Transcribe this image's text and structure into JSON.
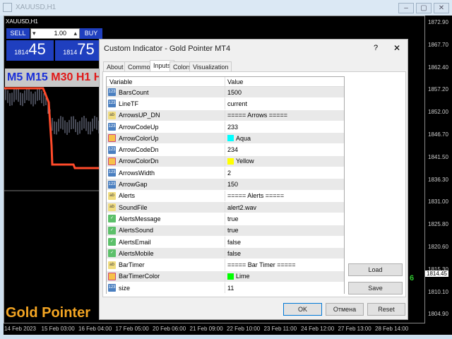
{
  "window": {
    "title": "XAUUSD,H1",
    "min": "‒",
    "max": "▢",
    "close": "✕"
  },
  "chart": {
    "symbol": "XAUUSD,H1",
    "sell": "SELL",
    "buy": "BUY",
    "lot": "1.00",
    "bid_big": "1814",
    "bid_small": "45",
    "ask_big": "1814",
    "ask_small": "75",
    "tf_blue": "M5 M15",
    "tf_red": "M30 H1 H",
    "brand": "Gold Pointer",
    "timer": "6",
    "prices": [
      "1872.90",
      "1867.70",
      "1862.40",
      "1857.20",
      "1852.00",
      "1846.70",
      "1841.50",
      "1836.30",
      "1831.00",
      "1825.80",
      "1820.60",
      "1815.30",
      "1810.10",
      "1804.90"
    ],
    "current_price": "1814.45",
    "times": [
      "14 Feb 2023",
      "15 Feb 03:00",
      "16 Feb 04:00",
      "17 Feb 05:00",
      "20 Feb 06:00",
      "21 Feb 09:00",
      "22 Feb 10:00",
      "23 Feb 11:00",
      "24 Feb 12:00",
      "27 Feb 13:00",
      "28 Feb 14:00"
    ]
  },
  "dialog": {
    "title": "Custom Indicator - Gold Pointer MT4",
    "help": "?",
    "close": "✕",
    "tabs": [
      "About",
      "Common",
      "Inputs",
      "Colors",
      "Visualization"
    ],
    "active_tab": "Inputs",
    "columns": [
      "Variable",
      "Value"
    ],
    "rows": [
      {
        "type": "num",
        "name": "BarsCount",
        "value": "1500"
      },
      {
        "type": "num",
        "name": "LineTF",
        "value": "current"
      },
      {
        "type": "str",
        "name": "ArrowsUP_DN",
        "value": "===== Arrows ====="
      },
      {
        "type": "num",
        "name": "ArrowCodeUp",
        "value": "233"
      },
      {
        "type": "col",
        "name": "ArrowColorUp",
        "value": "Aqua",
        "color": "#00ffff"
      },
      {
        "type": "num",
        "name": "ArrowCodeDn",
        "value": "234"
      },
      {
        "type": "col",
        "name": "ArrowColorDn",
        "value": "Yellow",
        "color": "#ffff00"
      },
      {
        "type": "num",
        "name": "ArrowsWidth",
        "value": "2"
      },
      {
        "type": "num",
        "name": "ArrowGap",
        "value": "150"
      },
      {
        "type": "str",
        "name": "Alerts",
        "value": "===== Alerts ====="
      },
      {
        "type": "str",
        "name": "SoundFile",
        "value": "alert2.wav"
      },
      {
        "type": "bool",
        "name": "AlertsMessage",
        "value": "true"
      },
      {
        "type": "bool",
        "name": "AlertsSound",
        "value": "true"
      },
      {
        "type": "bool",
        "name": "AlertsEmail",
        "value": "false"
      },
      {
        "type": "bool",
        "name": "AlertsMobile",
        "value": "false"
      },
      {
        "type": "str",
        "name": "BarTimer",
        "value": "===== Bar Timer ====="
      },
      {
        "type": "col",
        "name": "BarTimerColor",
        "value": "Lime",
        "color": "#00ff00"
      },
      {
        "type": "num",
        "name": "size",
        "value": "11"
      }
    ],
    "load": "Load",
    "save": "Save",
    "ok": "OK",
    "cancel": "Отмена",
    "reset": "Reset"
  }
}
